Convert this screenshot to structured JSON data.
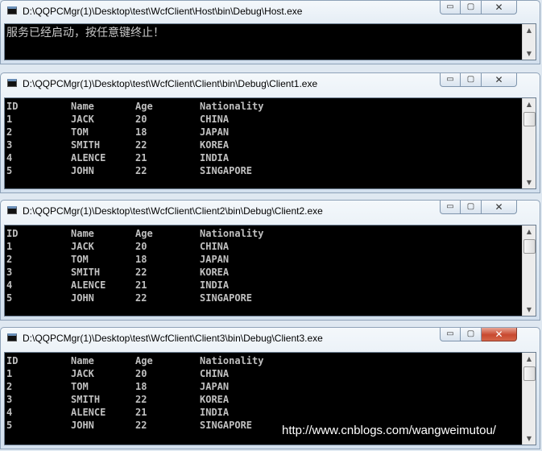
{
  "windows": [
    {
      "title": "D:\\QQPCMgr(1)\\Desktop\\test\\WcfClient\\Host\\bin\\Debug\\Host.exe",
      "message": "服务已经启动，按任意键终止！"
    },
    {
      "title": "D:\\QQPCMgr(1)\\Desktop\\test\\WcfClient\\Client\\bin\\Debug\\Client1.exe"
    },
    {
      "title": "D:\\QQPCMgr(1)\\Desktop\\test\\WcfClient\\Client2\\bin\\Debug\\Client2.exe"
    },
    {
      "title": "D:\\QQPCMgr(1)\\Desktop\\test\\WcfClient\\Client3\\bin\\Debug\\Client3.exe"
    }
  ],
  "table": {
    "headers": [
      "ID",
      "Name",
      "Age",
      "Nationality"
    ],
    "rows": [
      [
        "1",
        "JACK",
        "20",
        "CHINA"
      ],
      [
        "2",
        "TOM",
        "18",
        "JAPAN"
      ],
      [
        "3",
        "SMITH",
        "22",
        "KOREA"
      ],
      [
        "4",
        "ALENCE",
        "21",
        "INDIA"
      ],
      [
        "5",
        "JOHN",
        "22",
        "SINGAPORE"
      ]
    ]
  },
  "controls": {
    "minimize": "▭",
    "maximize": "▢",
    "close": "✕"
  },
  "scroll": {
    "up": "▲",
    "down": "▼"
  },
  "watermark": "http://www.cnblogs.com/wangweimutou/"
}
